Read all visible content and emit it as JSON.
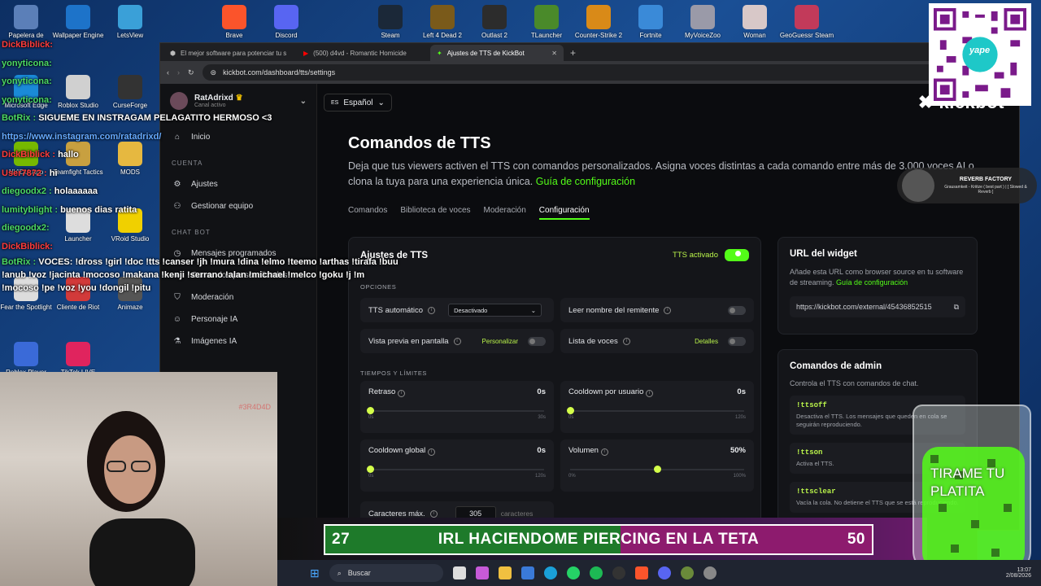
{
  "desktop_icons": [
    {
      "label": "Papelera de",
      "icon": "recycle-bin-icon",
      "color": "#5b7fb8"
    },
    {
      "label": "Wallpaper Engine",
      "icon": "wallpaper-engine-icon",
      "color": "#1d73c9"
    },
    {
      "label": "LetsView",
      "icon": "letsview-icon",
      "color": "#3aa0d8"
    },
    {
      "label": "Brave",
      "icon": "brave-icon",
      "color": "#fb542b"
    },
    {
      "label": "Discord",
      "icon": "discord-icon",
      "color": "#5865f2"
    },
    {
      "label": "Steam",
      "icon": "steam-icon",
      "color": "#1b2838"
    },
    {
      "label": "Left 4 Dead 2",
      "icon": "left4dead-icon",
      "color": "#7a5a1a"
    },
    {
      "label": "Outlast 2",
      "icon": "outlast-icon",
      "color": "#2c2c2c"
    },
    {
      "label": "TLauncher",
      "icon": "tlauncher-icon",
      "color": "#4a8a2a"
    },
    {
      "label": "Counter-Strike 2",
      "icon": "cs2-icon",
      "color": "#d98a18"
    },
    {
      "label": "Fortnite",
      "icon": "fortnite-icon",
      "color": "#3a8ad8"
    },
    {
      "label": "MyVoiceZoo",
      "icon": "myvoicezoo-icon",
      "color": "#9a9aa8"
    },
    {
      "label": "Woman",
      "icon": "woman-icon",
      "color": "#d8c8c8"
    },
    {
      "label": "GeoGuessr Steam",
      "icon": "geoguessr-icon",
      "color": "#c23a5a"
    },
    {
      "label": "Microsoft Edge",
      "icon": "edge-icon",
      "color": "#1a8ad8"
    },
    {
      "label": "Roblox Studio",
      "icon": "roblox-studio-icon",
      "color": "#d0d0d0"
    },
    {
      "label": "CurseForge",
      "icon": "curseforge-icon",
      "color": "#333"
    },
    {
      "label": "NVIDIA App",
      "icon": "nvidia-icon",
      "color": "#76b900"
    },
    {
      "label": "Teamfight Tactics",
      "icon": "tft-icon",
      "color": "#c8a040"
    },
    {
      "label": "MODS",
      "icon": "folder-icon",
      "color": "#e6b840"
    },
    {
      "label": "Launcher",
      "icon": "launcher-icon",
      "color": "#ddd"
    },
    {
      "label": "VRoid Studio",
      "icon": "vroid-icon",
      "color": "#f0d000"
    },
    {
      "label": "Fear the Spotlight",
      "icon": "fear-spotlight-icon",
      "color": "#ddd"
    },
    {
      "label": "Cliente de Riot",
      "icon": "riot-icon",
      "color": "#d23a3a"
    },
    {
      "label": "Animaze",
      "icon": "animaze-icon",
      "color": "#555"
    },
    {
      "label": "Roblox Player",
      "icon": "roblox-player-icon",
      "color": "#3a6ad8"
    },
    {
      "label": "TikTok LIVE",
      "icon": "tiktok-icon",
      "color": "#e0245e"
    }
  ],
  "browser": {
    "tabs": [
      {
        "title": "El mejor software para potenciar tu s",
        "active": false
      },
      {
        "title": "(500) d4vd - Romantic Homicide",
        "active": false
      },
      {
        "title": "Ajustes de TTS de KickBot",
        "active": true
      }
    ],
    "new_tab": "+",
    "url": "kickbot.com/dashboard/tts/settings"
  },
  "sidebar": {
    "channel_name": "RatAdrixd",
    "channel_sub": "Canal activo",
    "top": [
      {
        "label": "Inicio",
        "icon": "home-icon"
      }
    ],
    "section_account": "CUENTA",
    "account": [
      {
        "label": "Ajustes",
        "icon": "gear-icon"
      },
      {
        "label": "Gestionar equipo",
        "icon": "team-icon"
      }
    ],
    "section_chatbot": "CHAT BOT",
    "chatbot": [
      {
        "label": "Mensajes programados",
        "icon": "clock-icon"
      },
      {
        "label": "Comandos personalizados",
        "icon": "command-icon"
      },
      {
        "label": "Moderación",
        "icon": "shield-icon"
      },
      {
        "label": "Personaje IA",
        "icon": "robot-icon"
      },
      {
        "label": "Imágenes IA",
        "icon": "flask-icon"
      }
    ]
  },
  "main": {
    "language": "Español",
    "language_code": "ES",
    "logo": "kickbot",
    "title": "Comandos de TTS",
    "description": "Deja que tus viewers activen el TTS con comandos personalizados. Asigna voces distintas a cada comando entre más de 3.000 voces AI o clona la tuya para una experiencia única.",
    "guide_link": "Guía de configuración",
    "tabs": [
      {
        "label": "Comandos",
        "active": false
      },
      {
        "label": "Biblioteca de voces",
        "active": false
      },
      {
        "label": "Moderación",
        "active": false
      },
      {
        "label": "Configuración",
        "active": true
      }
    ]
  },
  "settings_card": {
    "title": "Ajustes de TTS",
    "tts_label": "TTS activado",
    "tts_on": true,
    "options_header": "OPCIONES",
    "auto_tts_label": "TTS automático",
    "auto_tts_value": "Desactivado",
    "read_sender_label": "Leer nombre del remitente",
    "read_sender_on": false,
    "preview_label": "Vista previa en pantalla",
    "preview_link": "Personalizar",
    "preview_on": false,
    "voices_label": "Lista de voces",
    "voices_link": "Detalles",
    "voices_on": false,
    "limits_header": "TIEMPOS Y LÍMITES",
    "sliders": [
      {
        "label": "Retraso",
        "value": "0s",
        "fraction": 0,
        "min": "0s",
        "max": "30s"
      },
      {
        "label": "Cooldown por usuario",
        "value": "0s",
        "fraction": 0,
        "min": "0s",
        "max": "120s"
      },
      {
        "label": "Cooldown global",
        "value": "0s",
        "fraction": 0,
        "min": "0s",
        "max": "120s"
      },
      {
        "label": "Volumen",
        "value": "50%",
        "fraction": 0.5,
        "min": "0%",
        "max": "100%"
      }
    ],
    "max_chars_label": "Caracteres máx.",
    "max_chars_value": "305",
    "max_chars_unit": "caracteres"
  },
  "widget_card": {
    "title": "URL del widget",
    "text": "Añade esta URL como browser source en tu software de streaming.",
    "link": "Guía de configuración",
    "url": "https://kickbot.com/external/45436852515"
  },
  "admin_card": {
    "title": "Comandos de admin",
    "text": "Controla el TTS con comandos de chat.",
    "commands": [
      {
        "cmd": "!ttsoff",
        "desc": "Desactiva el TTS. Los mensajes que queden en cola se seguirán reproduciendo."
      },
      {
        "cmd": "!ttson",
        "desc": "Activa el TTS."
      },
      {
        "cmd": "!ttsclear",
        "desc": "Vacía la cola. No detiene el TTS que se está reproduciendo."
      }
    ]
  },
  "chat_overlay": [
    {
      "user": "DickBiblick",
      "msg": "",
      "cls": "r"
    },
    {
      "user": "yonyticona",
      "msg": "",
      "cls": "u"
    },
    {
      "user": "yonyticona",
      "msg": "",
      "cls": "u"
    },
    {
      "user": "yonyticona",
      "msg": "",
      "cls": "u"
    },
    {
      "user": "BotRix",
      "msg": "SIGUEME EN INSTRAGAM PELAGATITO HERMOSO <3",
      "cls": "u"
    },
    {
      "user": "",
      "msg": "https://www.instagram.com/ratadrixd/",
      "cls": "link"
    },
    {
      "user": "DickBiblick",
      "msg": "hallo",
      "cls": "r"
    },
    {
      "user": "User7872",
      "msg": "hi",
      "cls": "r"
    },
    {
      "user": "diegoodx2",
      "msg": "holaaaaaa",
      "cls": "u"
    },
    {
      "user": "lumitybIight",
      "msg": "buenos dias ratita",
      "cls": "u"
    },
    {
      "user": "diegoodx2",
      "msg": "",
      "cls": "u"
    },
    {
      "user": "DickBiblick",
      "msg": "",
      "cls": "r"
    },
    {
      "user": "BotRix",
      "msg": "VOCES: !dross !girl !doc !tts !canser !jh !mura !dina !elmo !teemo !arthas !tirafa !buu !anub !voz !jacinta !mocoso !makana !kenji !serrano !alan !michael !melco !goku !j !m !mocoso !pe !voz !you !dongil !pitu",
      "cls": "u"
    }
  ],
  "reverb": {
    "title": "REVERB FACTORY",
    "subtitle": "Grausamkeit - Kriitze ( best part ) | [ Slowed & Reverb ]"
  },
  "qr_label": "yape",
  "banner": {
    "left": "27",
    "text": "IRL HACIENDOME PIERCING EN LA TETA",
    "right": "50"
  },
  "glass_text": "TIRAME TU PLATITA",
  "taskbar": {
    "search": "Buscar",
    "time": "13:07",
    "date": "2/08/2026"
  },
  "webcam_label": "#3R4D4D"
}
